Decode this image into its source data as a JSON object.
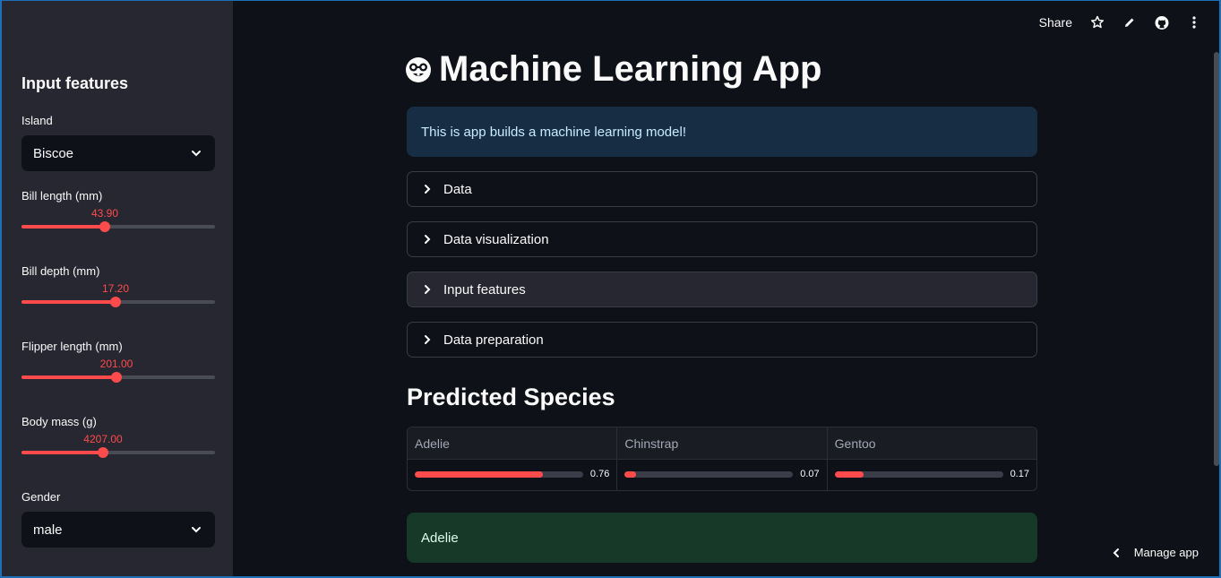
{
  "sidebar": {
    "title": "Input features",
    "island": {
      "label": "Island",
      "value": "Biscoe"
    },
    "sliders": [
      {
        "label": "Bill length (mm)",
        "value": "43.90",
        "fraction": 0.43
      },
      {
        "label": "Bill depth (mm)",
        "value": "17.20",
        "fraction": 0.485
      },
      {
        "label": "Flipper length (mm)",
        "value": "201.00",
        "fraction": 0.49
      },
      {
        "label": "Body mass (g)",
        "value": "4207.00",
        "fraction": 0.42
      }
    ],
    "gender": {
      "label": "Gender",
      "value": "male"
    }
  },
  "header": {
    "share_label": "Share",
    "icons": [
      "star-icon",
      "pencil-icon",
      "github-icon",
      "kebab-menu-icon"
    ]
  },
  "main": {
    "title": "Machine Learning App",
    "title_icon": "nerd-face-emoji",
    "info_text": "This is app builds a machine learning model!",
    "expanders": [
      "Data",
      "Data visualization",
      "Input features",
      "Data preparation"
    ],
    "predicted_heading": "Predicted Species",
    "species": [
      {
        "name": "Adelie",
        "value": 0.76,
        "label": "0.76"
      },
      {
        "name": "Chinstrap",
        "value": 0.07,
        "label": "0.07"
      },
      {
        "name": "Gentoo",
        "value": 0.17,
        "label": "0.17"
      }
    ],
    "result": "Adelie"
  },
  "footer": {
    "manage_label": "Manage app"
  },
  "colors": {
    "accent": "#ff4b4b",
    "background": "#0e1117",
    "sidebar": "#262730",
    "info": "#172d43",
    "success": "#173928"
  }
}
